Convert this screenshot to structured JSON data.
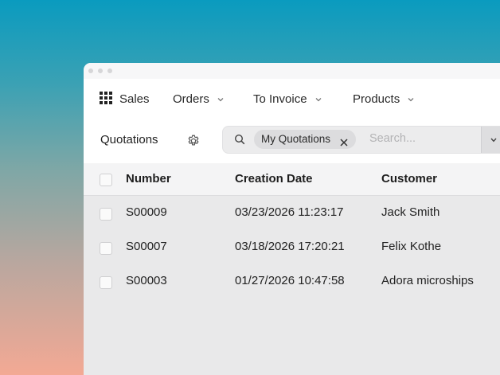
{
  "nav": {
    "app_name": "Sales",
    "menus": [
      {
        "label": "Orders"
      },
      {
        "label": "To Invoice"
      },
      {
        "label": "Products"
      }
    ]
  },
  "control_panel": {
    "breadcrumb": "Quotations",
    "search": {
      "facet": "My Quotations",
      "placeholder": "Search..."
    }
  },
  "table": {
    "columns": [
      "Number",
      "Creation Date",
      "Customer"
    ],
    "rows": [
      {
        "number": "S00009",
        "creation_date": "03/23/2026 11:23:17",
        "customer": "Jack Smith"
      },
      {
        "number": "S00007",
        "creation_date": "03/18/2026 17:20:21",
        "customer": "Felix Kothe"
      },
      {
        "number": "S00003",
        "creation_date": "01/27/2026 10:47:58",
        "customer": "Adora microships"
      }
    ]
  },
  "icons": {
    "apps": "grid-icon",
    "settings": "gear-icon",
    "search": "search-icon",
    "remove_facet": "close-icon",
    "toggle": "chevron-down-icon"
  },
  "colors": {
    "window_bg": "#e9e9ea",
    "header_bg": "#ffffff",
    "facet_bg": "#dcdcde"
  }
}
